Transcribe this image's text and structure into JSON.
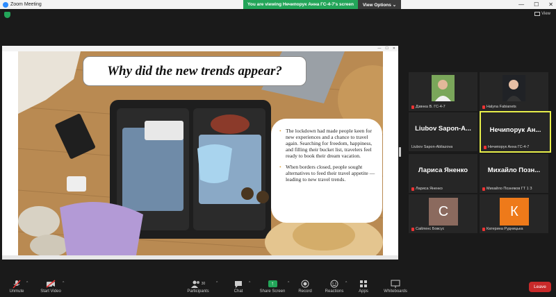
{
  "window": {
    "title": "Zoom Meeting"
  },
  "banner": {
    "text": "You are viewing Нечипорук Анна ГС-4-7's screen",
    "view_options": "View Options ⌄"
  },
  "view": {
    "label": "View"
  },
  "slide": {
    "title": "Why did the new trends appear?",
    "bullets": [
      "The lockdown had made people keen for new experiences and a chance to travel again. Searching for freedom, happiness, and filling their bucket list, travelers feel ready to book their dream vacation.",
      "When borders closed, people sought alternatives to feed their travel appetite — leading to new travel trends."
    ]
  },
  "participants": [
    {
      "name": "Дзвнка В. ГС-4-7",
      "big": "",
      "type": "photo"
    },
    {
      "name": "Halyna Fabianets",
      "big": "",
      "type": "photo"
    },
    {
      "name": "Liubov Sapon-Abliazova",
      "big": "Liubov Sapon-A...",
      "type": "name"
    },
    {
      "name": "Нечипорук Анна ГС-4-7",
      "big": "Нечипорук Ан...",
      "type": "name",
      "active": true
    },
    {
      "name": "Лариса Яненко",
      "big": "Лариса Яненко",
      "type": "name"
    },
    {
      "name": "Михайло Позняков ГТ 1 З",
      "big": "Михайло Позн...",
      "type": "name"
    },
    {
      "name": "Сайленс Бовсус",
      "big": "",
      "type": "letter",
      "letter": "С",
      "color": "#8b6a5e"
    },
    {
      "name": "Катерина Рудницька",
      "big": "",
      "type": "letter",
      "letter": "К",
      "color": "#ee7a1a"
    }
  ],
  "toolbar": {
    "unmute": "Unmute",
    "start_video": "Start Video",
    "participants": "Participants",
    "participants_count": "30",
    "chat": "Chat",
    "share_screen": "Share Screen",
    "record": "Record",
    "reactions": "Reactions",
    "apps": "Apps",
    "whiteboards": "Whiteboards",
    "leave": "Leave"
  }
}
